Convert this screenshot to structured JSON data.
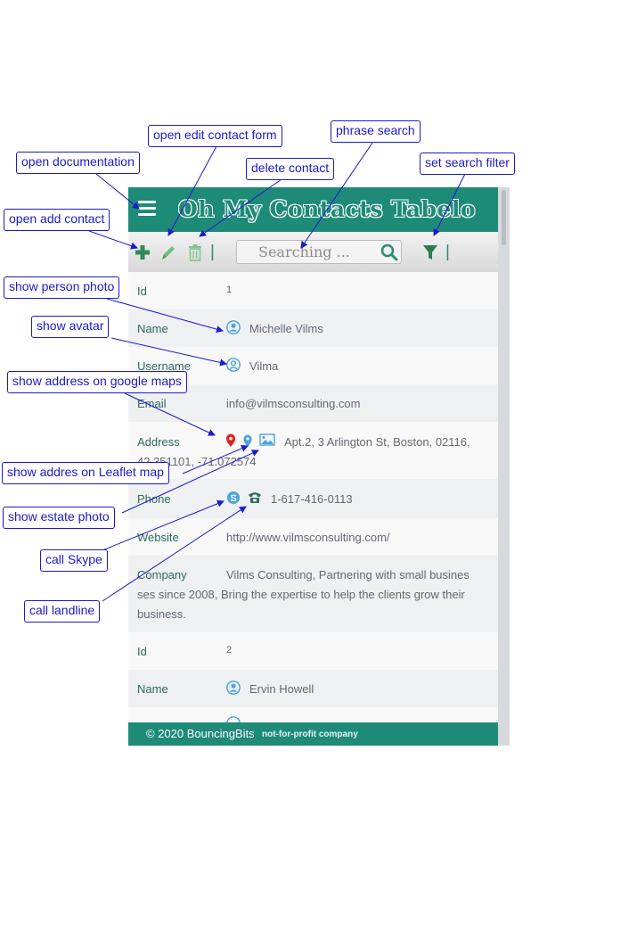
{
  "app": {
    "title": "Oh My  Contacts  Tabelo",
    "search_placeholder": "Searching ...",
    "toolbar_separator": "|",
    "footer_copyright": "© 2020 BouncingBits",
    "footer_subtitle": "not-for-profit company"
  },
  "icons": {
    "menu": "hamburger-icon",
    "add": "plus-icon",
    "edit": "pencil-icon",
    "delete": "trash-icon",
    "search": "magnifier-icon",
    "filter": "funnel-icon",
    "person_photo": "person-circle-icon",
    "avatar": "avatar-icon",
    "google_maps": "map-marker-icon",
    "leaflet_map": "map-pin-icon",
    "estate_photo": "picture-icon",
    "skype": "skype-icon",
    "landline": "phone-icon"
  },
  "colors": {
    "brand_teal": "#1e8a78",
    "annotation_blue": "#1a1acf",
    "google_marker_red": "#e02020",
    "icon_blue": "#4aa3df"
  },
  "contacts": [
    {
      "id_label": "Id",
      "id": "1",
      "name_label": "Name",
      "name": "Michelle Vilms",
      "username_label": "Username",
      "username": "Vilma",
      "email_label": "Email",
      "email": "info@vilmsconsulting.com",
      "address_label": "Address",
      "address_line1": "Apt.2, 3 Arlington St, Boston, 02116,",
      "address_line2": "42.351101, -71.072574",
      "phone_label": "Phone",
      "phone": "1-617-416-0113",
      "website_label": "Website",
      "website": "http://www.vilmsconsulting.com/",
      "company_label": "Company",
      "company_line1": "Vilms Consulting, Partnering with small busines",
      "company_line2": "ses since 2008, Bring the expertise to help the clients grow their",
      "company_line3": "business."
    },
    {
      "id_label": "Id",
      "id": "2",
      "name_label": "Name",
      "name": "Ervin Howell"
    }
  ],
  "annotations": {
    "open_documentation": "open documentation",
    "open_edit_contact_form": "open edit contact form",
    "delete_contact": "delete contact",
    "phrase_search": "phrase search",
    "set_search_filter": "set search filter",
    "open_add_contact": "open add contact",
    "show_person_photo": "show person photo",
    "show_avatar": "show avatar",
    "show_address_on_google_maps": "show address on google maps",
    "show_address_on_leaflet_map": "show addres on Leaflet map",
    "show_estate_photo": "show estate photo",
    "call_skype": "call Skype",
    "call_landline": "call landline"
  }
}
